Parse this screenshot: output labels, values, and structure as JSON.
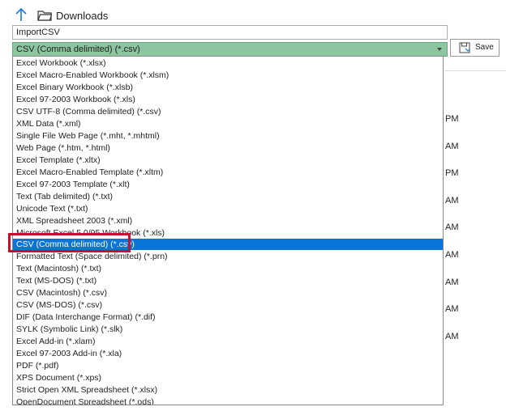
{
  "location": {
    "name": "Downloads"
  },
  "file_name": {
    "value": "ImportCSV"
  },
  "file_type": {
    "selected": "CSV (Comma delimited) (*.csv)",
    "options": [
      "Excel Workbook (*.xlsx)",
      "Excel Macro-Enabled Workbook (*.xlsm)",
      "Excel Binary Workbook (*.xlsb)",
      "Excel 97-2003 Workbook (*.xls)",
      "CSV UTF-8 (Comma delimited) (*.csv)",
      "XML Data (*.xml)",
      "Single File Web Page (*.mht, *.mhtml)",
      "Web Page (*.htm, *.html)",
      "Excel Template (*.xltx)",
      "Excel Macro-Enabled Template (*.xltm)",
      "Excel 97-2003 Template (*.xlt)",
      "Text (Tab delimited) (*.txt)",
      "Unicode Text (*.txt)",
      "XML Spreadsheet 2003 (*.xml)",
      "Microsoft Excel 5.0/95 Workbook (*.xls)",
      "CSV (Comma delimited) (*.csv)",
      "Formatted Text (Space delimited) (*.prn)",
      "Text (Macintosh) (*.txt)",
      "Text (MS-DOS) (*.txt)",
      "CSV (Macintosh) (*.csv)",
      "CSV (MS-DOS) (*.csv)",
      "DIF (Data Interchange Format) (*.dif)",
      "SYLK (Symbolic Link) (*.slk)",
      "Excel Add-in (*.xlam)",
      "Excel 97-2003 Add-in (*.xla)",
      "PDF (*.pdf)",
      "XPS Document (*.xps)",
      "Strict Open XML Spreadsheet (*.xlsx)",
      "OpenDocument Spreadsheet (*.ods)"
    ]
  },
  "save_button": {
    "label": "Save"
  },
  "background_times": [
    "PM",
    "AM",
    "PM",
    "AM",
    "AM",
    "AM",
    "AM",
    "AM",
    "AM"
  ],
  "colors": {
    "select_bg": "#8cc6a0",
    "selected_option_bg": "#0a74d7",
    "highlight_border": "#c8102e",
    "arrow_blue": "#1e7ad6"
  }
}
